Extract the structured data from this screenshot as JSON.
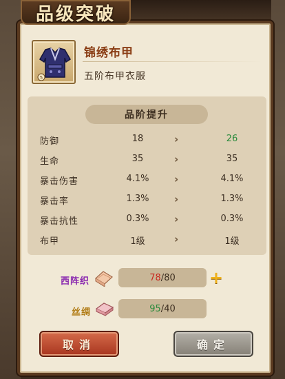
{
  "dialog": {
    "title": "品级突破"
  },
  "item": {
    "name": "锦绣布甲",
    "description": "五阶布甲衣服"
  },
  "panel": {
    "heading": "品阶提升",
    "arrow": "›",
    "stats": [
      {
        "name": "防御",
        "old": "18",
        "new": "26",
        "increased": true
      },
      {
        "name": "生命",
        "old": "35",
        "new": "35",
        "increased": false
      },
      {
        "name": "暴击伤害",
        "old": "4.1%",
        "new": "4.1%",
        "increased": false
      },
      {
        "name": "暴击率",
        "old": "1.3%",
        "new": "1.3%",
        "increased": false
      },
      {
        "name": "暴击抗性",
        "old": "0.3%",
        "new": "0.3%",
        "increased": false
      },
      {
        "name": "布甲",
        "old": "1级",
        "new": "1级",
        "increased": false
      }
    ]
  },
  "materials": [
    {
      "name": "西阵织",
      "have": "78",
      "separator": "/",
      "need": "80",
      "color": "#8b2bb0"
    },
    {
      "name": "丝绸",
      "have": "95",
      "separator": "/",
      "need": "40",
      "color": "#b07a12"
    }
  ],
  "plus_label": "+",
  "buttons": {
    "cancel": "取消",
    "confirm": "确定"
  },
  "colors": {
    "stat_increase": "#2a8a3c",
    "insufficient": "#c9271e"
  }
}
